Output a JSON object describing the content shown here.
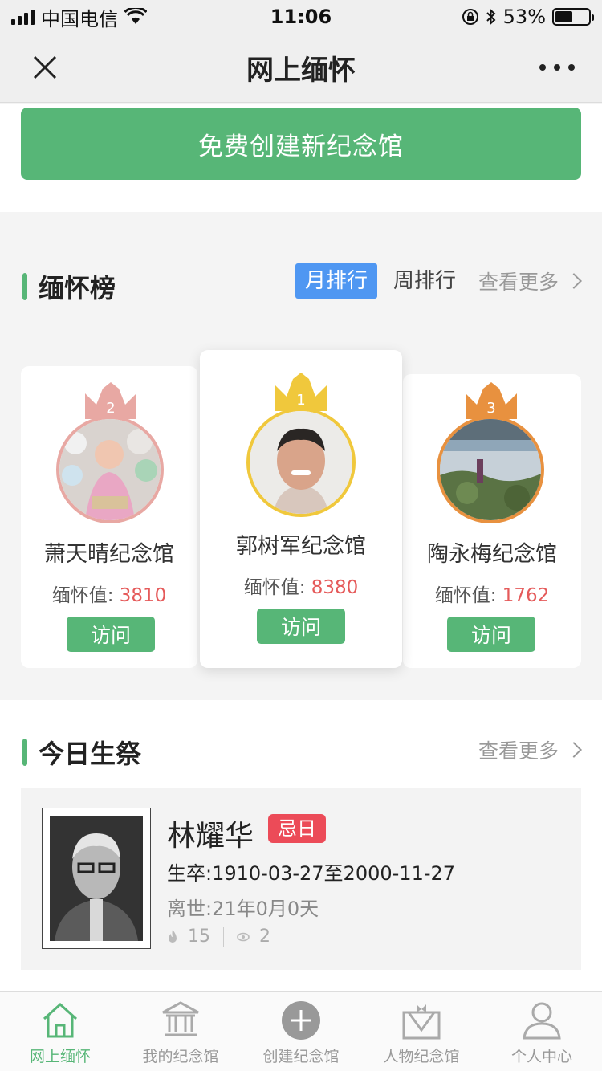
{
  "status_bar": {
    "carrier": "中国电信",
    "time": "11:06",
    "battery": "53%",
    "battery_level": 0.53
  },
  "nav": {
    "title": "网上缅怀"
  },
  "create_button": {
    "label": "免费创建新纪念馆"
  },
  "ranking": {
    "title": "缅怀榜",
    "tab_month": "月排行",
    "tab_week": "周排行",
    "more": "查看更多",
    "score_label": "缅怀值:",
    "visit_label": "访问",
    "cards": [
      {
        "rank": "2",
        "name": "萧天晴纪念馆",
        "score": "3810",
        "crown_color": "#e8a8a3",
        "ring_color": "#e8a8a3"
      },
      {
        "rank": "1",
        "name": "郭树军纪念馆",
        "score": "8380",
        "crown_color": "#f0c83c",
        "ring_color": "#f0c83c"
      },
      {
        "rank": "3",
        "name": "陶永梅纪念馆",
        "score": "1762",
        "crown_color": "#e8913f",
        "ring_color": "#e8913f"
      }
    ]
  },
  "today": {
    "title": "今日生祭",
    "more": "查看更多",
    "person": {
      "name": "林耀华",
      "badge": "忌日",
      "life": "生卒:1910-03-27至2000-11-27",
      "passed": "离世:21年0月0天",
      "flowers": "15",
      "views": "2"
    }
  },
  "tab_bar": {
    "items": [
      {
        "label": "网上缅怀",
        "icon": "home-icon",
        "active": true
      },
      {
        "label": "我的纪念馆",
        "icon": "memorial-hall-icon",
        "active": false
      },
      {
        "label": "创建纪念馆",
        "icon": "plus-circle-icon",
        "active": false
      },
      {
        "label": "人物纪念馆",
        "icon": "person-memorial-icon",
        "active": false
      },
      {
        "label": "个人中心",
        "icon": "user-icon",
        "active": false
      }
    ]
  }
}
